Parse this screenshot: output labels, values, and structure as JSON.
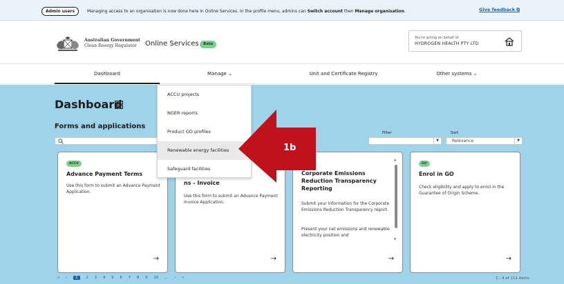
{
  "announcement": {
    "pill": "Admin users",
    "message_parts": [
      "Managing access to an organisation is now done here in Online Services. In the profile menu, admins can ",
      "Switch account",
      " then ",
      "Manage organisation",
      "."
    ],
    "feedback_link": "Give feedback ⧉"
  },
  "header": {
    "gov_line1": "Australian Government",
    "gov_line2": "Clean Energy Regulator",
    "app_title": "Online Services",
    "beta_badge": "Beta",
    "org_label": "You're acting on behalf of",
    "org_name": "HYDROGEN HEALTH PTY LTD"
  },
  "nav": {
    "items": [
      {
        "label": "Dashboard"
      },
      {
        "label": "Manage ⌄"
      },
      {
        "label": "Unit and Certificate Registry"
      },
      {
        "label": "Other systems ⌄"
      }
    ]
  },
  "manage_menu": {
    "items": [
      {
        "label": "ACCU projects"
      },
      {
        "label": "NGER reports"
      },
      {
        "label": "Product GO profiles"
      },
      {
        "label": "Renewable energy facilities"
      },
      {
        "label": "Safeguard facilities"
      }
    ],
    "highlighted_index": 3
  },
  "main": {
    "page_title": "Dashboard",
    "section_title": "Forms and applications",
    "filter_label": "Filter",
    "sort_label": "Sort",
    "sort_value": "Relevance",
    "cards": [
      {
        "badge": "ACCU",
        "title": "Advance Payment Terms",
        "desc": "Use this form to submit an Advance Payment Application."
      },
      {
        "badge": "",
        "title": "ns - Invoice",
        "desc": "Use this form to submit an Advance Payment Invoice Application."
      },
      {
        "badge": "",
        "title": "Corporate Emissions Reduction Transparency Reporting",
        "desc": "Submit your information for the Corporate Emissions Reduction Transparency report.",
        "desc2": "Present your net emissions and renewable electricity position and"
      },
      {
        "badge": "GO",
        "title": "Enrol in GO",
        "desc": "Check eligibility and apply to enrol in the Guarantee of Origin Scheme."
      }
    ],
    "arrow": "→"
  },
  "pagination": {
    "first": "«",
    "prev": "‹",
    "pages": [
      "1",
      "2",
      "3",
      "4",
      "5",
      "6",
      "7",
      "8",
      "9",
      "10",
      "..."
    ],
    "next": "›",
    "last": "»",
    "count": "1 - 4 of 111 items"
  },
  "annotation": {
    "label": "1b",
    "color": "#c0121c"
  },
  "colors": {
    "band": "#9fd3ea",
    "badge_green": "#7ccf8f",
    "link_blue": "#1d5fa0"
  }
}
